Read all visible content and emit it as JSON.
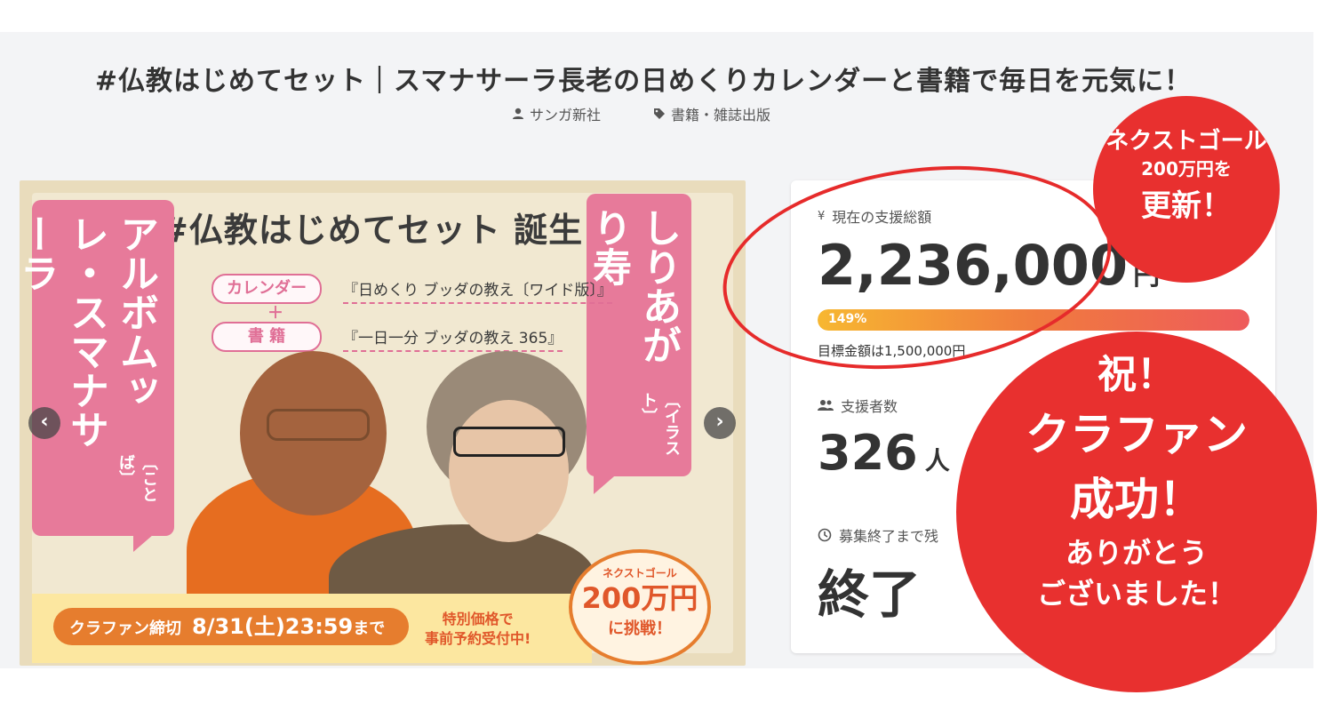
{
  "project": {
    "title": "#仏教はじめてセット｜スマナサーラ長老の日めくりカレンダーと書籍で毎日を元気に！",
    "organizer": "サンガ新社",
    "category": "書籍・雑誌出版"
  },
  "banner": {
    "headline": "#仏教はじめてセット 誕生！",
    "left_bubble_small": "〔ことば〕",
    "left_bubble_name": "アルボムッレ・スマナサーラ",
    "right_bubble_small": "〔イラスト〕",
    "right_bubble_name": "しりあがり寿",
    "item1_pill": "カレンダー",
    "item1_name": "『日めくり ブッダの教え〔ワイド版〕』",
    "plus": "＋",
    "item2_pill": "書 籍",
    "item2_name": "『一日一分 ブッダの教え 365』",
    "deadline_label": "クラファン締切",
    "deadline_date": "8/31(土)23:59",
    "deadline_suffix": "まで",
    "special_line1": "特別価格で",
    "special_line2": "事前予約受付中!",
    "goal_badge_top": "ネクストゴール",
    "goal_badge_amount": "200万円",
    "goal_badge_bottom": "に挑戦！",
    "prev_label": "‹",
    "next_label": "›"
  },
  "stats": {
    "funding_label": "現在の支援総額",
    "amount": "2,236,000",
    "amount_unit": "円",
    "progress_text": "149%",
    "progress_fraction": 1.0,
    "goal_text": "目標金額は1,500,000円",
    "backers_label": "支援者数",
    "backers": "326",
    "backers_unit": "人",
    "remaining_label": "募集終了まで残",
    "remaining_value": "終了"
  },
  "overlay": {
    "small_line1": "ネクストゴール",
    "small_line2": "200万円を",
    "small_line3": "更新！",
    "big_line1": "祝！",
    "big_line2": "クラファン",
    "big_line3": "成功！",
    "big_line4": "ありがとう",
    "big_line5": "ございました！"
  },
  "colors": {
    "accent_red": "#e8302f",
    "banner_pink": "#e77a9a",
    "banner_orange": "#e67d2e",
    "progress_start": "#f7b731",
    "progress_end": "#ee5b5b"
  },
  "icons": {
    "organizer": "user-icon",
    "category": "tag-icon",
    "funding": "yen-icon",
    "backers": "users-icon",
    "remaining": "clock-icon"
  }
}
